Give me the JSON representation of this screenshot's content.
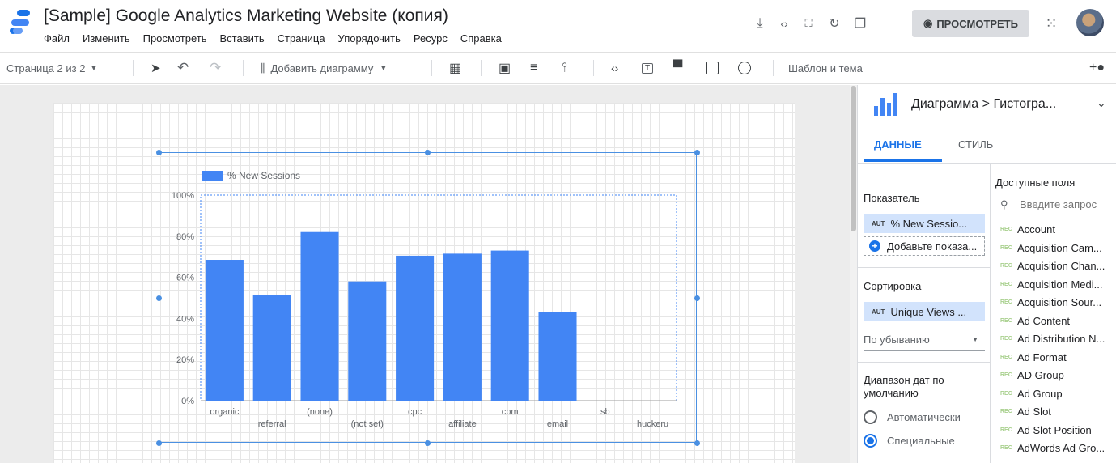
{
  "app": {
    "title": "[Sample] Google Analytics Marketing Website (копия)",
    "menu": [
      "Файл",
      "Изменить",
      "Просмотреть",
      "Вставить",
      "Страница",
      "Упорядочить",
      "Ресурс",
      "Справка"
    ],
    "preview_label": "ПРОСМОТРЕТЬ"
  },
  "toolbar": {
    "page_indicator": "Страница 2 из 2",
    "add_chart_label": "Добавить диаграмму",
    "theme_label": "Шаблон и тема"
  },
  "panel": {
    "breadcrumb": "Диаграмма > Гистогра...",
    "tabs": [
      "ДАННЫЕ",
      "СТИЛЬ"
    ],
    "active_tab": "ДАННЫЕ",
    "metric_label": "Показатель",
    "metric_chip": "% New Sessio...",
    "metric_type": "AUT",
    "add_metric": "Добавьте показа...",
    "sort_label": "Сортировка",
    "sort_chip": "Unique Views ...",
    "sort_type": "AUT",
    "sort_order": "По убыванию",
    "date_range_label": "Диапазон дат по умолчанию",
    "date_options": [
      "Автоматически",
      "Специальные"
    ],
    "date_selected": "Специальные",
    "available_label": "Доступные поля",
    "search_placeholder": "Введите запрос",
    "fields": [
      "Account",
      "Acquisition Cam...",
      "Acquisition Chan...",
      "Acquisition Medi...",
      "Acquisition Sour...",
      "Ad Content",
      "Ad Distribution N...",
      "Ad Format",
      "AD Group",
      "Ad Group",
      "Ad Slot",
      "Ad Slot Position",
      "AdWords Ad Gro..."
    ],
    "field_type": "REC"
  },
  "chart_data": {
    "type": "bar",
    "legend": [
      "% New Sessions"
    ],
    "legend_position": "top-left",
    "categories": [
      "organic",
      "referral",
      "(none)",
      "(not set)",
      "cpc",
      "affiliate",
      "cpm",
      "email",
      "sb",
      "huckeru"
    ],
    "series": [
      {
        "name": "% New Sessions",
        "values": [
          68.5,
          51.5,
          82,
          58,
          70.5,
          71.5,
          73,
          43,
          0,
          0
        ]
      }
    ],
    "ylim": [
      0,
      100
    ],
    "yticks": [
      "0%",
      "20%",
      "40%",
      "60%",
      "80%",
      "100%"
    ],
    "grid": false,
    "colors": {
      "bar": "#4285f4",
      "selection": "#4a90e2"
    }
  }
}
